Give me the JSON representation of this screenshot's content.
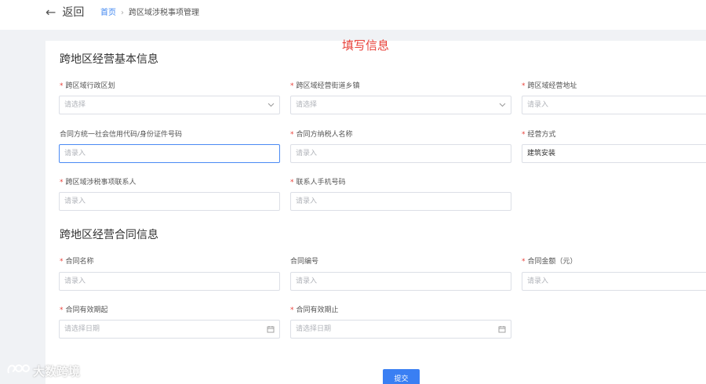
{
  "header": {
    "back_label": "返回",
    "breadcrumb": {
      "home": "首页",
      "separator": "›",
      "current": "跨区域涉税事项管理"
    }
  },
  "annotation": "填写信息",
  "sections": {
    "basic": "跨地区经营基本信息",
    "contract": "跨地区经营合同信息"
  },
  "required_mark": "*",
  "fields": {
    "admin_region": {
      "label": "跨区域行政区划",
      "placeholder": "请选择"
    },
    "street_town": {
      "label": "跨区域经营街道乡镇",
      "placeholder": "请选择"
    },
    "address": {
      "label": "跨区域经营地址",
      "placeholder": "请录入"
    },
    "contract_party_id": {
      "label": "合同方统一社会信用代码/身份证件号码",
      "placeholder": "请录入"
    },
    "contract_party_name": {
      "label": "合同方纳税人名称",
      "placeholder": "请录入"
    },
    "business_mode": {
      "label": "经营方式",
      "value": "建筑安装"
    },
    "contact_person": {
      "label": "跨区域涉税事项联系人",
      "placeholder": "请录入"
    },
    "contact_phone": {
      "label": "联系人手机号码",
      "placeholder": "请录入"
    },
    "contract_name": {
      "label": "合同名称",
      "placeholder": "请录入"
    },
    "contract_no": {
      "label": "合同编号",
      "placeholder": "请录入"
    },
    "contract_amount": {
      "label": "合同金额（元）",
      "placeholder": "请录入"
    },
    "valid_from": {
      "label": "合同有效期起",
      "placeholder": "请选择日期"
    },
    "valid_to": {
      "label": "合同有效期止",
      "placeholder": "请选择日期"
    }
  },
  "submit_label": "提交",
  "watermark": "大数跨境",
  "colors": {
    "accent": "#3a7ff3",
    "required": "#e8413a",
    "link": "#3f86f0"
  }
}
